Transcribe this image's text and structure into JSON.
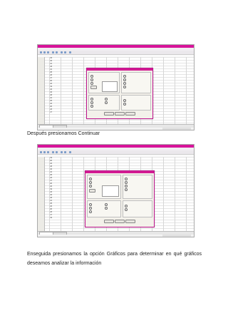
{
  "captions": {
    "caption1": "Después presionamos Continuar",
    "para_line1": "Enseguida presionamos la opción Gráficos para determinar en qué gráficos",
    "para_line2": "deseamos analizar la información"
  },
  "screenshot1": {
    "rows": [
      "15",
      "16",
      "21",
      "18",
      "21",
      "25",
      "23",
      "17",
      "20",
      "22",
      "19",
      "24",
      "16",
      "18",
      "21",
      "25",
      "22",
      "20",
      "23",
      "17"
    ]
  },
  "screenshot2": {
    "rows": [
      "19",
      "20",
      "22",
      "18",
      "16",
      "21",
      "25",
      "23",
      "17",
      "20",
      "22",
      "19",
      "24",
      "16",
      "18",
      "21",
      "25",
      "22",
      "20",
      "23",
      "17",
      "19"
    ]
  },
  "colors": {
    "titlebar": "#d7149a",
    "dialog_border": "#c0168f"
  }
}
